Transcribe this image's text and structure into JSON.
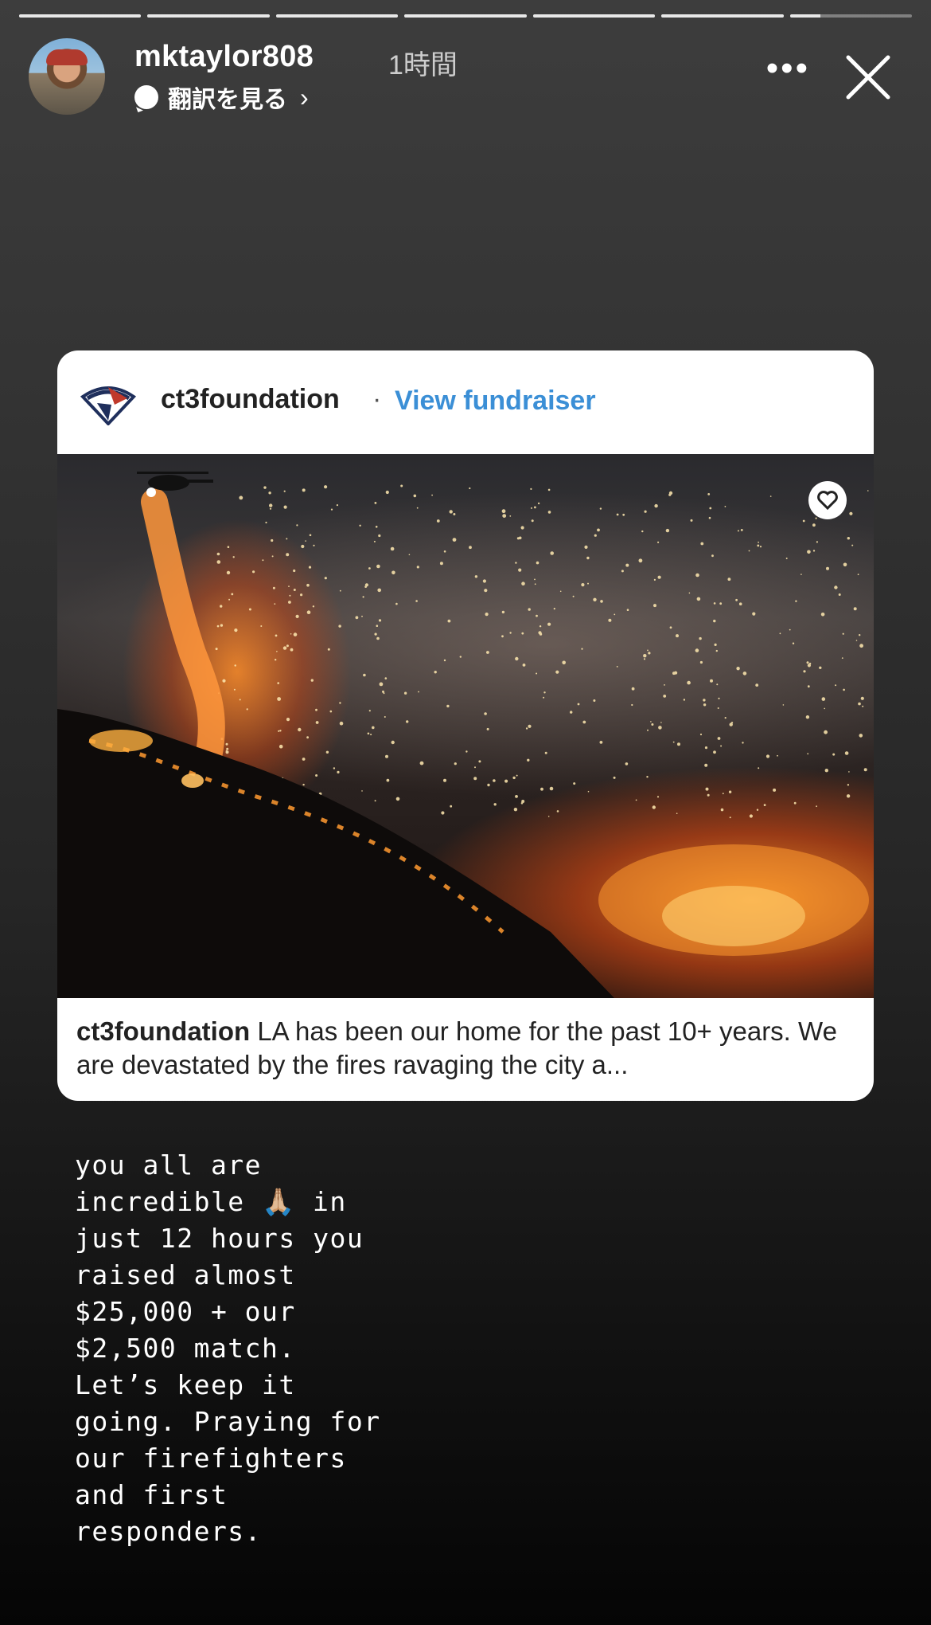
{
  "progress": {
    "segments": 7,
    "completed": 6,
    "current_fraction": 0.25
  },
  "header": {
    "username": "mktaylor808",
    "time": "1時間",
    "translate_label": "翻訳を見る",
    "more_label": "•••"
  },
  "card": {
    "username": "ct3foundation",
    "separator": "·",
    "action_label": "View fundraiser",
    "caption_user": "ct3foundation",
    "caption_text": " LA has been our home for the past 10+ years. We are devastated by the fires ravaging the city a..."
  },
  "story_text": "you all are\nincredible 🙏🏼 in\njust 12 hours you\nraised almost\n$25,000 + our\n$2,500 match.\nLet’s keep it\ngoing. Praying for\nour firefighters\nand first\nresponders.",
  "colors": {
    "accent": "#3b8fd6",
    "card_bg": "#ffffff"
  }
}
